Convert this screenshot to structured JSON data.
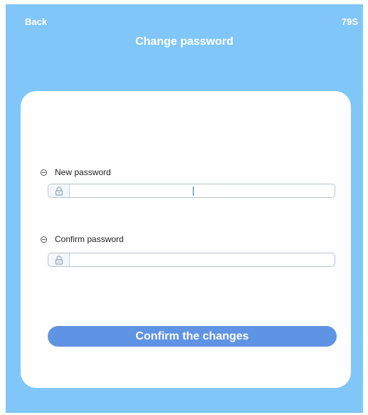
{
  "header": {
    "back_label": "Back",
    "countdown": "79S",
    "title": "Change password"
  },
  "form": {
    "new_password": {
      "label": "New password",
      "value": "",
      "icon": "lock-icon"
    },
    "confirm_password": {
      "label": "Confirm password",
      "value": "",
      "icon": "lock-icon"
    },
    "submit_label": "Confirm the changes"
  },
  "colors": {
    "background": "#80c6f9",
    "card": "#ffffff",
    "button": "#5f93e3"
  }
}
